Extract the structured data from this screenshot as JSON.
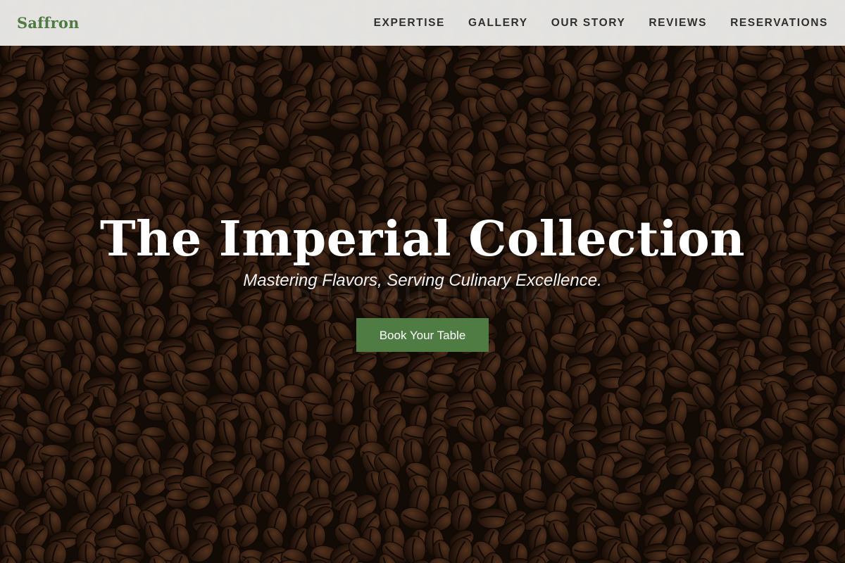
{
  "navbar": {
    "brand": "Saffron",
    "links": [
      {
        "label": "EXPERTISE"
      },
      {
        "label": "GALLERY"
      },
      {
        "label": "OUR STORY"
      },
      {
        "label": "REVIEWS"
      },
      {
        "label": "RESERVATIONS"
      }
    ]
  },
  "hero": {
    "title": "The Imperial Collection",
    "subtitle": "Mastering Flavors, Serving Culinary Excellence.",
    "cta_label": "Book Your Table",
    "watermark": "stispatter.asia",
    "background": "coffee-beans-image"
  },
  "colors": {
    "brand_green": "#4f7a42",
    "button_green": "#4f7c43",
    "navbar_bg": "#e9e9e7",
    "nav_text": "#2f2f2f",
    "hero_text": "#ffffff"
  }
}
